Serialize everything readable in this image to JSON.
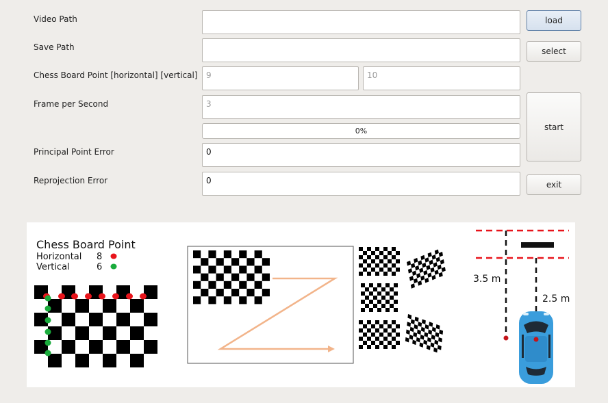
{
  "form": {
    "video_path": {
      "label": "Video Path",
      "value": ""
    },
    "save_path": {
      "label": "Save Path",
      "value": ""
    },
    "chess_board_point": {
      "label": "Chess Board Point [horizontal] [vertical]",
      "horizontal_placeholder": "9",
      "vertical_placeholder": "10"
    },
    "fps": {
      "label": "Frame per Second",
      "placeholder": "3"
    },
    "progress": {
      "value": 0,
      "text": "0%"
    },
    "principal_point_error": {
      "label": "Principal Point Error",
      "value": "0"
    },
    "reprojection_error": {
      "label": "Reprojection Error",
      "value": "0"
    }
  },
  "buttons": {
    "load": "load",
    "select": "select",
    "start": "start",
    "exit": "exit"
  },
  "illustration": {
    "legend_title": "Chess Board Point",
    "horizontal_label": "Horizontal",
    "horizontal_count": "8",
    "vertical_label": "Vertical",
    "vertical_count": "6",
    "dist_far": "3.5 m",
    "dist_near": "2.5 m",
    "colors": {
      "horizontal_point": "#e8141b",
      "vertical_point": "#1aab3c",
      "path_arrow": "#f2b48a",
      "car": "#3a9ddc",
      "dashed_line": "#e8141b"
    }
  }
}
